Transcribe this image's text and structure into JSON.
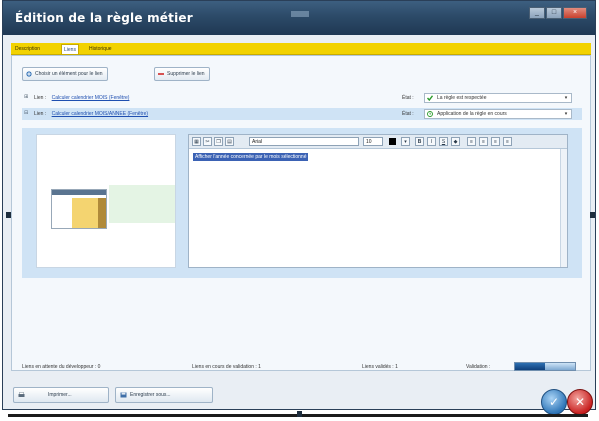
{
  "window": {
    "title": "Édition de la règle métier"
  },
  "tabs": [
    {
      "label": "Description",
      "active": false
    },
    {
      "label": "Liens",
      "active": true
    },
    {
      "label": "Historique",
      "active": false
    }
  ],
  "toolbar": {
    "add_label": "Choisir un élément pour le lien",
    "remove_label": "Supprimer le lien"
  },
  "links": [
    {
      "prefix": "Lien :",
      "name": "Calculer calendrier MOIS (Fenêtre)",
      "etat_label": "État :",
      "etat_value": "La règle est respectée",
      "etat_icon": "check-icon",
      "etat_color": "#2a9a2a"
    },
    {
      "prefix": "Lien :",
      "name": "Calculer calendrier MOIS/ANNEE (Fenêtre)",
      "etat_label": "État :",
      "etat_value": "Application de la règle en cours",
      "etat_icon": "clock-icon",
      "etat_color": "#2a9a2a"
    }
  ],
  "editor": {
    "font": "Arial",
    "size": "10",
    "text": "Afficher l'année concernée par le mois sélectionné"
  },
  "status": {
    "pending_dev": "Liens en attente du développeur : 0",
    "in_validation": "Liens en cours de validation : 1",
    "validated": "Liens validés : 1",
    "validation_label": "Validation :",
    "validation_fraction": 0.5
  },
  "footer": {
    "print_label": "Imprimer...",
    "save_label": "Enregistrer sous..."
  },
  "colors": {
    "tab_bar": "#f2d200",
    "title_bar": "#2c4a68",
    "selection": "#cfe3f5"
  }
}
